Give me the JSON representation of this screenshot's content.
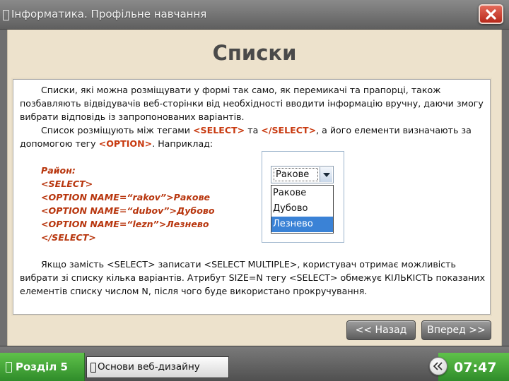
{
  "window": {
    "title": "Інформатика. Профільне навчання",
    "close_icon": "close-x-icon",
    "accent_close": "#c9301f"
  },
  "slide": {
    "title": "Списки"
  },
  "content": {
    "para1": "Списки, які можна розміщувати у формі так само, як перемикачі та прапорці, також позбавляють відвідувачів веб-сторінки від необхідності вводити інформацію вручну, даючи змогу вибрати відповідь із запропонованих варіантів.",
    "para2_a": "Список розміщують між тегами ",
    "para2_tag1": "<SELECT>",
    "para2_b": " та ",
    "para2_tag2": "</SELECT>",
    "para2_c": ", а його елементи визначають за допомогою тегу ",
    "para2_tag3": "<OPTION>",
    "para2_d": ". Наприклад:",
    "code": {
      "line1": "Район:",
      "line2": "<SELECT>",
      "line3": "<OPTION NAME=“rakov”>Ракове",
      "line4": "<OPTION NAME=“dubov”>Дубово",
      "line5": "<OPTION NAME=“lezn”>Лезнево",
      "line6": "</SELECT>"
    },
    "para3": "Якщо замість <SELECT> записати <SELECT MULTIPLE>, користувач отримає можливість вибрати зі списку кілька варіантів. Атрибут SIZE=N тегу <SELECT> обмежує КІЛЬКІСТЬ показаних елементів списку числом N, після чого буде використано прокручування."
  },
  "select_demo": {
    "selected_value": "Ракове",
    "options": [
      "Ракове",
      "Дубово",
      "Лезнево"
    ],
    "highlighted_option": "Лезнево"
  },
  "nav": {
    "back_label": "<< Назад",
    "next_label": "Вперед >>"
  },
  "footer": {
    "section_label": "Розділ 5",
    "topic_label": "Основи веб-дизайну",
    "time": "07:47",
    "section_color": "#3fa63a"
  }
}
